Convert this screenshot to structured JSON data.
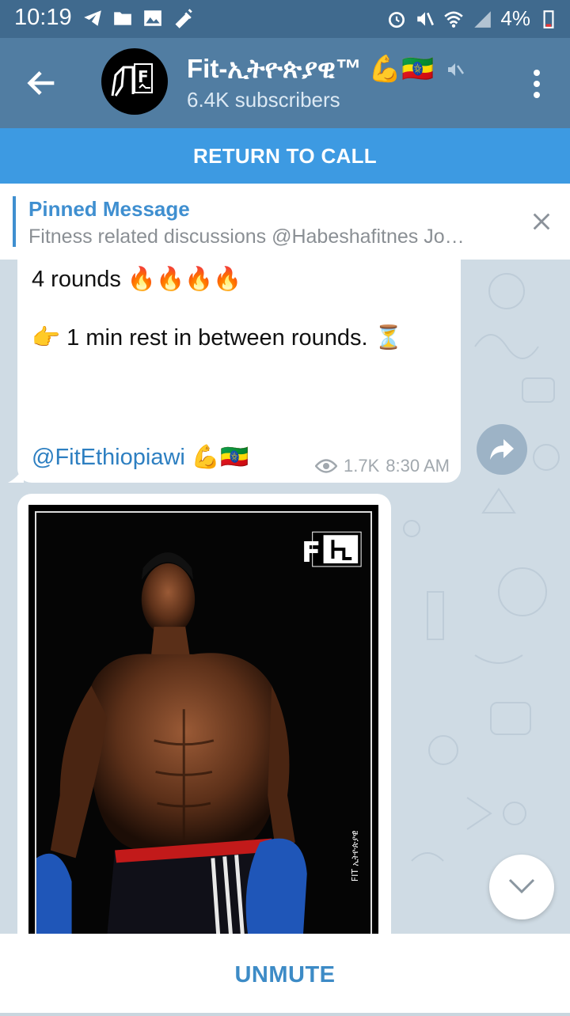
{
  "status": {
    "time": "10:19",
    "battery": "4%"
  },
  "header": {
    "title": "Fit-ኢትዮጵያዊ™",
    "title_emoji": "💪🇪🇹",
    "subtitle": "6.4K subscribers",
    "avatar_text": "F"
  },
  "call_bar": {
    "label": "RETURN TO CALL"
  },
  "pinned": {
    "title": "Pinned Message",
    "text": "Fitness related discussions @Habeshafitnes Jo…"
  },
  "messages": [
    {
      "line1": "4 rounds 🔥🔥🔥🔥",
      "line2": "👉 1 min rest in between rounds. ⏳",
      "link": "@FitEthiopiawi 💪🇪🇹",
      "views": "1.7K",
      "time": "8:30 AM"
    }
  ],
  "photo": {
    "logo_text": "F",
    "watermark": "FIT ኢትዮጵያዊ"
  },
  "bottom": {
    "label": "UNMUTE"
  }
}
